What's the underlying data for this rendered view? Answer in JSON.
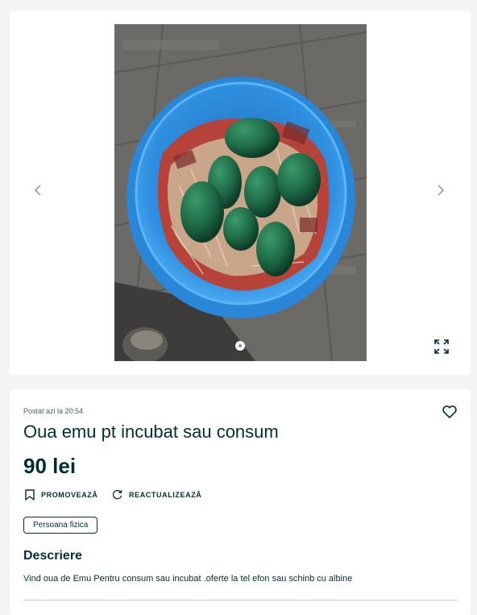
{
  "gallery": {
    "image_alt": "Oua emu in lighean albastru",
    "prev_icon": "chevron-left-icon",
    "next_icon": "chevron-right-icon",
    "fullscreen_icon": "expand-icon",
    "dots_total": 1,
    "active_dot": 1
  },
  "listing": {
    "posted": "Postat azi la 20:54",
    "title": "Oua emu pt incubat sau consum",
    "price": "90 lei",
    "favorite_icon": "heart-outline-icon",
    "promote_label": "PROMOVEAZĂ",
    "refresh_label": "REACTUALIZEAZĂ",
    "seller_type": "Persoana fizica"
  },
  "description": {
    "heading": "Descriere",
    "text": "Vind oua de Emu Pentru consum sau incubat .oferte la tel efon sau schinb cu albine"
  },
  "colors": {
    "text": "#002f34",
    "bowl": "#2f8fe0",
    "egg": "#1f6b47",
    "floor": "#6b6a67"
  }
}
